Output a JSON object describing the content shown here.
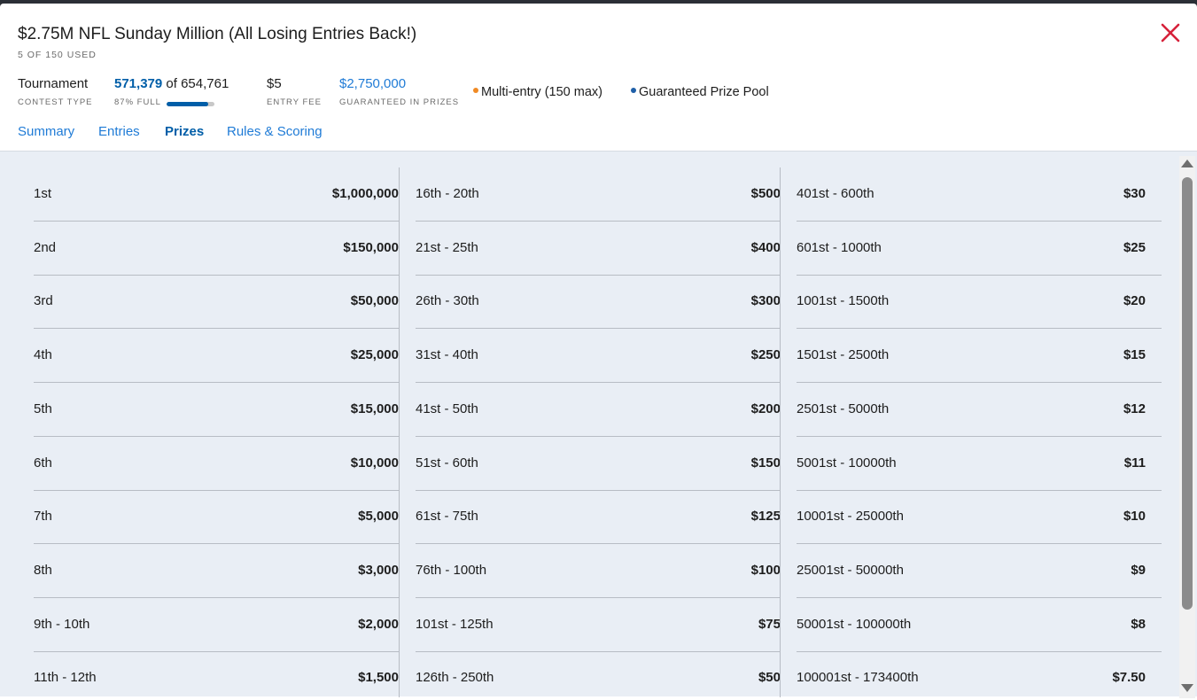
{
  "contest": {
    "title": "$2.75M NFL Sunday Million (All Losing Entries Back!)",
    "used": "5 OF 150 USED"
  },
  "stats": {
    "type_value": "Tournament",
    "type_label": "CONTEST TYPE",
    "entries_current": "571,379",
    "entries_of": " of 654,761",
    "full_label": "87% FULL",
    "full_fraction": 0.87,
    "fee_value": "$5",
    "fee_label": "ENTRY FEE",
    "prizes_value": "$2,750,000",
    "prizes_label": "GUARANTEED IN PRIZES"
  },
  "tags": {
    "multi": "Multi-entry (150 max)",
    "gpp": "Guaranteed Prize Pool"
  },
  "colors": {
    "accent": "#1f7bd6",
    "close": "#d6213a",
    "multi_dot": "#f08a24",
    "gpp_dot": "#1f5fa8"
  },
  "tabs": [
    {
      "label": "Summary"
    },
    {
      "label": "Entries"
    },
    {
      "label": "Prizes"
    },
    {
      "label": "Rules & Scoring"
    }
  ],
  "prizes": {
    "col0": [
      {
        "place": "1st",
        "amount": "$1,000,000"
      },
      {
        "place": "2nd",
        "amount": "$150,000"
      },
      {
        "place": "3rd",
        "amount": "$50,000"
      },
      {
        "place": "4th",
        "amount": "$25,000"
      },
      {
        "place": "5th",
        "amount": "$15,000"
      },
      {
        "place": "6th",
        "amount": "$10,000"
      },
      {
        "place": "7th",
        "amount": "$5,000"
      },
      {
        "place": "8th",
        "amount": "$3,000"
      },
      {
        "place": "9th - 10th",
        "amount": "$2,000"
      },
      {
        "place": "11th - 12th",
        "amount": "$1,500"
      }
    ],
    "col1": [
      {
        "place": "16th - 20th",
        "amount": "$500"
      },
      {
        "place": "21st - 25th",
        "amount": "$400"
      },
      {
        "place": "26th - 30th",
        "amount": "$300"
      },
      {
        "place": "31st - 40th",
        "amount": "$250"
      },
      {
        "place": "41st - 50th",
        "amount": "$200"
      },
      {
        "place": "51st - 60th",
        "amount": "$150"
      },
      {
        "place": "61st - 75th",
        "amount": "$125"
      },
      {
        "place": "76th - 100th",
        "amount": "$100"
      },
      {
        "place": "101st - 125th",
        "amount": "$75"
      },
      {
        "place": "126th - 250th",
        "amount": "$50"
      }
    ],
    "col2": [
      {
        "place": "401st - 600th",
        "amount": "$30"
      },
      {
        "place": "601st - 1000th",
        "amount": "$25"
      },
      {
        "place": "1001st - 1500th",
        "amount": "$20"
      },
      {
        "place": "1501st - 2500th",
        "amount": "$15"
      },
      {
        "place": "2501st - 5000th",
        "amount": "$12"
      },
      {
        "place": "5001st - 10000th",
        "amount": "$11"
      },
      {
        "place": "10001st - 25000th",
        "amount": "$10"
      },
      {
        "place": "25001st - 50000th",
        "amount": "$9"
      },
      {
        "place": "50001st - 100000th",
        "amount": "$8"
      },
      {
        "place": "100001st - 173400th",
        "amount": "$7.50"
      }
    ]
  }
}
